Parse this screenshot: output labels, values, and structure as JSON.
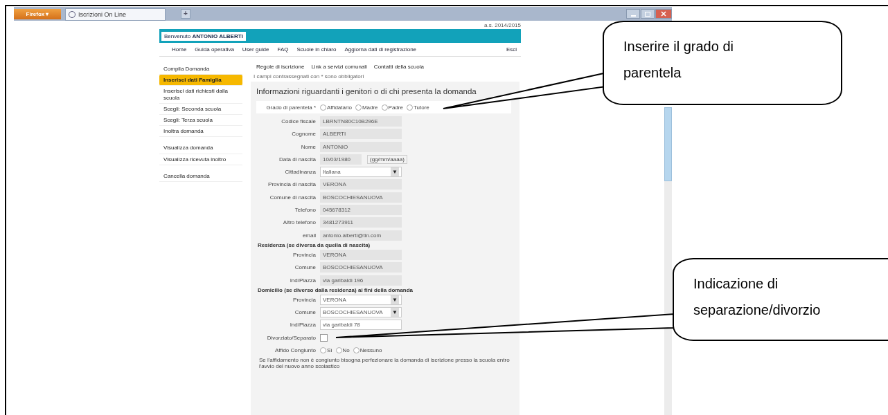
{
  "browser": {
    "menu_button": "Firefox",
    "menu_caret": "▾",
    "tab_title": "Iscrizioni On Line",
    "new_tab": "+"
  },
  "page": {
    "school_year": "a.s. 2014/2015",
    "welcome": "Benvenuto **ANTONIO ALBERTI**",
    "nav": [
      "Home",
      "Guida operativa",
      "User guide",
      "FAQ",
      "Scuole in chiaro",
      "Aggiorna dati di registrazione"
    ],
    "logout": "Esci",
    "sidebar": {
      "groups": [
        {
          "items": [
            {
              "label": "Compila Domanda",
              "selected": false
            },
            {
              "label": "Inserisci dati Famiglia",
              "selected": true
            },
            {
              "label": "Inserisci dati richiesti dalla scuola",
              "selected": false
            },
            {
              "label": "Scegli: Seconda scuola",
              "selected": false
            },
            {
              "label": "Scegli: Terza scuola",
              "selected": false
            },
            {
              "label": "Inoltra domanda",
              "selected": false
            }
          ]
        },
        {
          "items": [
            {
              "label": "Visualizza domanda",
              "selected": false
            },
            {
              "label": "Visualizza ricevuta inoltro",
              "selected": false
            }
          ]
        },
        {
          "items": [
            {
              "label": "Cancella domanda",
              "selected": false
            }
          ]
        }
      ]
    },
    "subtabs": [
      "Regole di iscrizione",
      "Link a servizi comunali",
      "Contatti della scuola"
    ],
    "required_note": "I campi contrassegnati con * sono obbligatori",
    "heading": "Informazioni riguardanti i genitori o di chi presenta la domanda",
    "rows": [
      {
        "kind": "radio",
        "label": "Grado di parentela *",
        "options": [
          {
            "label": "Affidatario",
            "selected": false
          },
          {
            "label": "Madre",
            "selected": false
          },
          {
            "label": "Padre",
            "selected": false
          },
          {
            "label": "Tutore",
            "selected": false
          }
        ]
      },
      {
        "kind": "text",
        "label": "Codice fiscale",
        "value": "LBRNTN80C10B296E",
        "disabled": true
      },
      {
        "kind": "text",
        "label": "Cognome",
        "value": "ALBERTI",
        "disabled": true
      },
      {
        "kind": "text",
        "label": "Nome",
        "value": "ANTONIO",
        "disabled": true
      },
      {
        "kind": "date",
        "label": "Data di nascita",
        "value": "10/03/1980",
        "hint": "(gg/mm/aaaa)",
        "disabled": true
      },
      {
        "kind": "select",
        "label": "Cittadinanza",
        "value": "Italiana",
        "caret": "▼",
        "disabled": false
      },
      {
        "kind": "text",
        "label": "Provincia di nascita",
        "value": "VERONA",
        "disabled": true
      },
      {
        "kind": "text",
        "label": "Comune di nascita",
        "value": "BOSCOCHIESANUOVA",
        "disabled": true
      },
      {
        "kind": "text",
        "label": "Telefono",
        "value": "045678312",
        "disabled": true
      },
      {
        "kind": "text",
        "label": "Altro telefono",
        "value": "3481273911",
        "disabled": true
      },
      {
        "kind": "text",
        "label": "email",
        "value": "antonio.alberti@tin.com",
        "disabled": true
      },
      {
        "kind": "section",
        "label": "Residenza (se diversa da quella di nascita)"
      },
      {
        "kind": "text",
        "label": "Provincia",
        "value": "VERONA",
        "disabled": true
      },
      {
        "kind": "text",
        "label": "Comune",
        "value": "BOSCOCHIESANUOVA",
        "disabled": true
      },
      {
        "kind": "text",
        "label": "Ind/Piazza",
        "value": "via garibaldi 196",
        "disabled": true
      },
      {
        "kind": "section",
        "label": "Domicilio (se diverso dalla residenza) ai fini della domanda"
      },
      {
        "kind": "select",
        "label": "Provincia",
        "value": "VERONA",
        "caret": "▼",
        "disabled": false
      },
      {
        "kind": "select",
        "label": "Comune",
        "value": "BOSCOCHIESANUOVA",
        "caret": "▼",
        "disabled": false
      },
      {
        "kind": "text",
        "label": "Ind/Piazza",
        "value": "via garibaldi 78",
        "disabled": false
      },
      {
        "kind": "checkbox",
        "label": "Divorziato/Separato",
        "checked": false
      },
      {
        "kind": "radio",
        "label": "Affido Congiunto",
        "options": [
          {
            "label": "Sì",
            "selected": false
          },
          {
            "label": "No",
            "selected": false
          },
          {
            "label": "Nessuno",
            "selected": false
          }
        ]
      },
      {
        "kind": "note",
        "label": "Se l'affidamento non è congiunto bisogna perfezionare la domanda di iscrizione presso la scuola entro l'avvio del nuovo anno scolastico"
      }
    ]
  },
  "callouts": [
    {
      "text": "Inserire il grado di parentela"
    },
    {
      "text": "Indicazione di separazione/divorzio"
    }
  ]
}
